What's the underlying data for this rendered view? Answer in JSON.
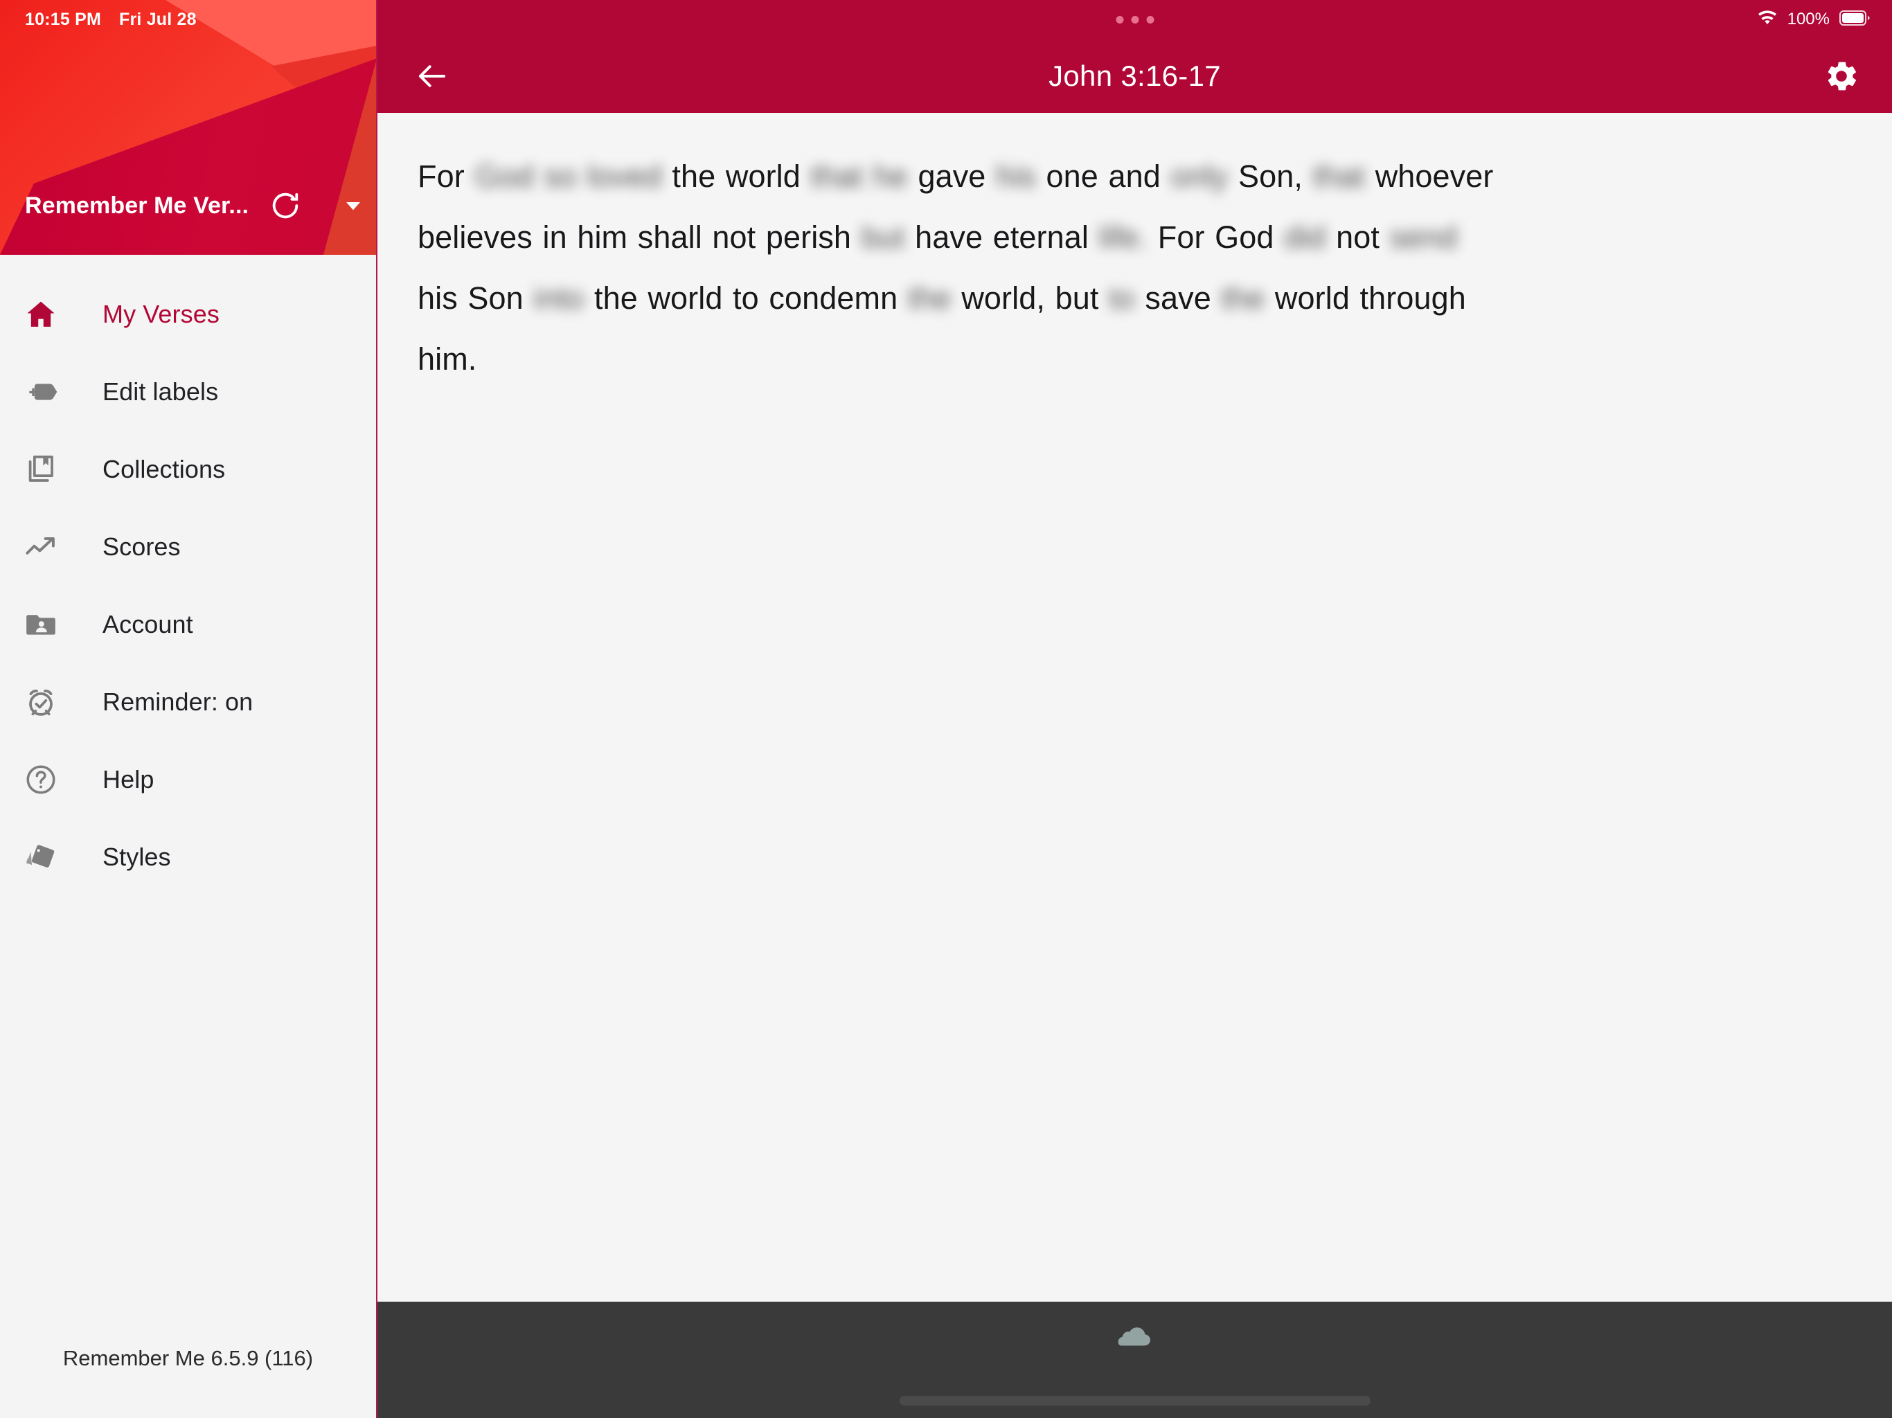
{
  "status_bar": {
    "time": "10:15 PM",
    "date": "Fri Jul 28",
    "battery_percent": "100%",
    "wifi_icon": "wifi-icon",
    "battery_icon": "battery-full-icon",
    "handle_icon": "three-dots-handle"
  },
  "drawer": {
    "account_name": "Remember Me Ver...",
    "refresh_icon": "refresh-icon",
    "dropdown_icon": "chevron-down-icon",
    "items": [
      {
        "label": "My Verses",
        "icon": "home-icon",
        "active": true
      },
      {
        "label": "Edit labels",
        "icon": "label-add-icon",
        "active": false
      },
      {
        "label": "Collections",
        "icon": "library-book-icon",
        "active": false
      },
      {
        "label": "Scores",
        "icon": "trending-up-icon",
        "active": false
      },
      {
        "label": "Account",
        "icon": "folder-user-icon",
        "active": false
      },
      {
        "label": "Reminder: on",
        "icon": "alarm-check-icon",
        "active": false
      },
      {
        "label": "Help",
        "icon": "help-circle-icon",
        "active": false
      },
      {
        "label": "Styles",
        "icon": "style-card-icon",
        "active": false
      }
    ],
    "version": "Remember Me 6.5.9 (116)"
  },
  "appbar": {
    "back_icon": "back-arrow-icon",
    "title": "John 3:16-17",
    "settings_icon": "gear-icon"
  },
  "verse": {
    "reference": "John 3:16-17",
    "tokens": [
      {
        "text": "For",
        "hidden": false
      },
      {
        "text": "God so loved",
        "hidden": true
      },
      {
        "text": "the world",
        "hidden": false
      },
      {
        "text": "that he",
        "hidden": true
      },
      {
        "text": "gave",
        "hidden": false
      },
      {
        "text": "his",
        "hidden": true
      },
      {
        "text": "one and",
        "hidden": false
      },
      {
        "text": "only",
        "hidden": true
      },
      {
        "text": "Son,",
        "hidden": false
      },
      {
        "text": "that",
        "hidden": true
      },
      {
        "text": "whoever believes in him shall not perish",
        "hidden": false
      },
      {
        "text": "but",
        "hidden": true
      },
      {
        "text": "have eternal",
        "hidden": false
      },
      {
        "text": "life.",
        "hidden": true
      },
      {
        "text": "For God",
        "hidden": false
      },
      {
        "text": "did",
        "hidden": true
      },
      {
        "text": "not",
        "hidden": false
      },
      {
        "text": "send",
        "hidden": true
      },
      {
        "text": "his Son",
        "hidden": false
      },
      {
        "text": "into",
        "hidden": true
      },
      {
        "text": "the world to condemn",
        "hidden": false
      },
      {
        "text": "the",
        "hidden": true
      },
      {
        "text": "world,",
        "hidden": false
      },
      {
        "text": "but",
        "hidden": false
      },
      {
        "text": "to",
        "hidden": true
      },
      {
        "text": "save",
        "hidden": false
      },
      {
        "text": "the",
        "hidden": true
      },
      {
        "text": "world through him.",
        "hidden": false
      }
    ]
  },
  "bottom_bar": {
    "sync_icon": "cloud-icon",
    "home_indicator": "home-indicator-bar"
  },
  "colors": {
    "brand_crimson": "#b10737",
    "drawer_header_red": "#f0201c",
    "drawer_bg": "#f4f4f5",
    "content_bg": "#f5f5f5",
    "bottom_bar": "#3a3a3a",
    "icon_gray": "#7d7d7d",
    "cloud_gray": "#93a3a2"
  }
}
